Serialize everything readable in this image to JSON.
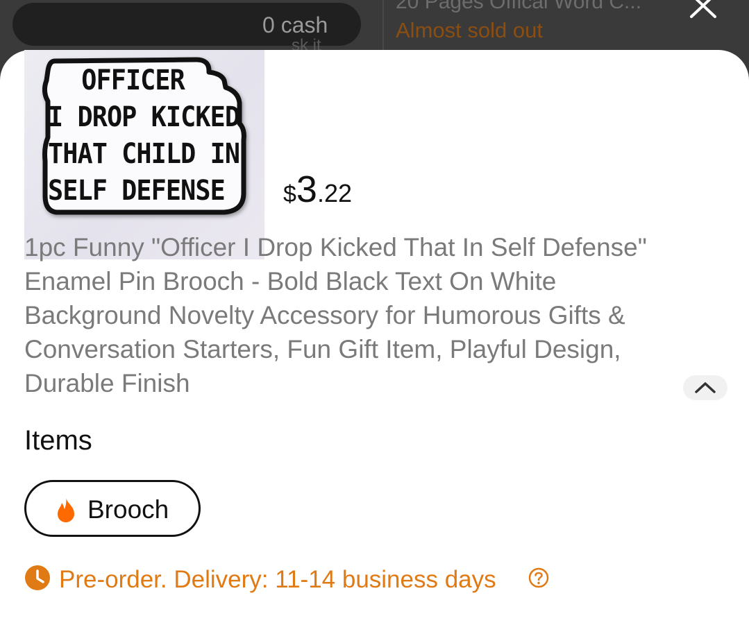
{
  "background": {
    "pill_text": "0 cash",
    "ghost_text": "sk it",
    "right_card_title": "20 Pages Offical Word C...",
    "right_card_status": "Almost sold out"
  },
  "close_button": {
    "icon": "close-icon"
  },
  "product": {
    "image_text": [
      "OFFICER",
      "I DROP KICKED",
      "THAT CHILD IN",
      "SELF DEFENSE"
    ],
    "price": {
      "currency": "$",
      "integer": "3",
      "decimal": ".22"
    },
    "title": "1pc Funny \"Officer I Drop Kicked That In Self Defense\" Enamel Pin Brooch - Bold Black Text On White Background Novelty Accessory for Humorous Gifts & Conversation Starters, Fun Gift Item, Playful Design, Durable Finish"
  },
  "items": {
    "heading": "Items",
    "options": [
      {
        "label": "Brooch",
        "icon": "fire-icon",
        "selected": true
      }
    ]
  },
  "delivery": {
    "text": "Pre-order. Delivery: 11-14 business days",
    "color": "#e07a14"
  },
  "colors": {
    "accent": "#e07a14",
    "text": "#111111",
    "muted": "#7a7a7a"
  }
}
